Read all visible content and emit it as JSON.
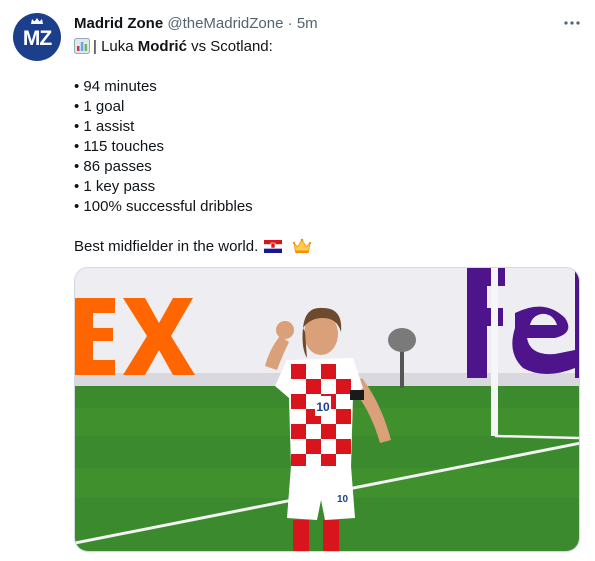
{
  "tweet": {
    "display_name": "Madrid Zone",
    "handle": "@theMadridZone",
    "separator": "·",
    "time": "5m",
    "avatar_text": "MZ",
    "more_icon": "more-horizontal-icon",
    "title_prefix": "| Luka ",
    "title_bold": "Modrić",
    "title_suffix": " vs Scotland:",
    "stats": [
      "• 94 minutes",
      "• 1 goal",
      "• 1 assist",
      "• 115 touches",
      "• 86 passes",
      "• 1 key pass",
      "• 100% successful dribbles"
    ],
    "closing_text": "Best midfielder in the world.",
    "emojis": [
      "bar-chart-emoji",
      "croatia-flag-emoji",
      "crown-emoji"
    ]
  },
  "colors": {
    "avatar_bg": "#1c3f8c",
    "meta_gray": "#536471",
    "text": "#0f1419",
    "fedex_orange": "#ff6600",
    "fedex_purple": "#4d148c",
    "pitch_green": "#3c8a2e",
    "shirt_red": "#d8141c"
  }
}
